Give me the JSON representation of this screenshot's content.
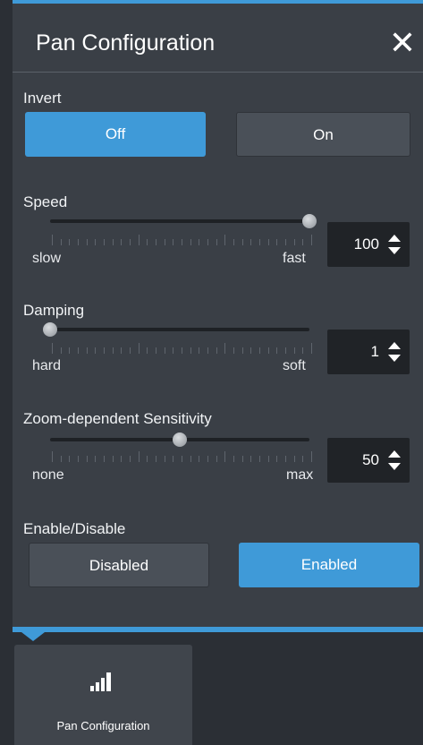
{
  "panel": {
    "title": "Pan Configuration",
    "close_glyph": "✕",
    "accent_color": "#3f9ad8"
  },
  "invert": {
    "label": "Invert",
    "options": [
      "Off",
      "On"
    ],
    "selected": "Off"
  },
  "speed": {
    "label": "Speed",
    "min_label": "slow",
    "max_label": "fast",
    "value": "100",
    "level": 1.0
  },
  "damping": {
    "label": "Damping",
    "min_label": "hard",
    "max_label": "soft",
    "value": "1",
    "level": 0.0
  },
  "zoom_sensitivity": {
    "label": "Zoom-dependent Sensitivity",
    "min_label": "none",
    "max_label": "max",
    "value": "50",
    "level": 0.5
  },
  "enable": {
    "label": "Enable/Disable",
    "options": [
      "Disabled",
      "Enabled"
    ],
    "selected": "Enabled"
  },
  "dock": {
    "item_label": "Pan Configuration",
    "icon": "signal-bars-icon"
  }
}
